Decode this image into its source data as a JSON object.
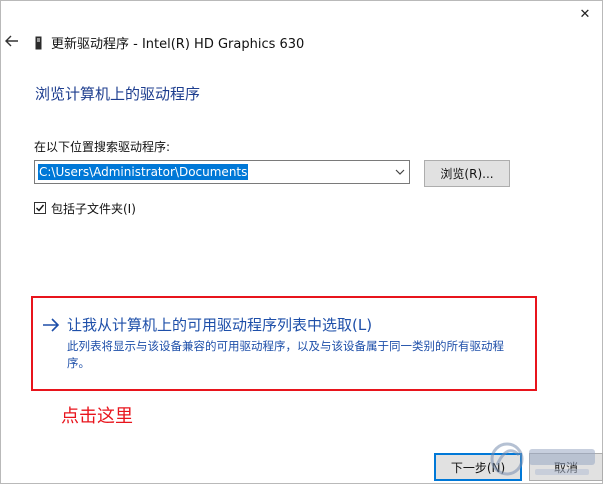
{
  "window": {
    "title": "更新驱动程序 - Intel(R) HD Graphics 630",
    "close_glyph": "✕"
  },
  "main": {
    "heading": "浏览计算机上的驱动程序",
    "search_label": "在以下位置搜索驱动程序:",
    "path_value": "C:\\Users\\Administrator\\Documents",
    "browse_label": "浏览(R)...",
    "include_subfolders_label": "包括子文件夹(I)",
    "include_subfolders_checked": true
  },
  "pick_option": {
    "title": "让我从计算机上的可用驱动程序列表中选取(L)",
    "description": "此列表将显示与该设备兼容的可用驱动程序，以及与该设备属于同一类别的所有驱动程序。"
  },
  "annotation": {
    "text": "点击这里"
  },
  "footer": {
    "next_label": "下一步(N)",
    "cancel_label": "取消"
  },
  "colors": {
    "link_blue": "#1e4fa9",
    "heading_blue": "#1e3e8f",
    "highlight_red": "#e8141c",
    "selection_blue": "#0078d7"
  },
  "icons": {
    "back": "back-arrow-icon",
    "device": "device-icon",
    "dropdown": "chevron-down-icon",
    "option_arrow": "right-arrow-icon",
    "checkbox": "check-icon"
  }
}
